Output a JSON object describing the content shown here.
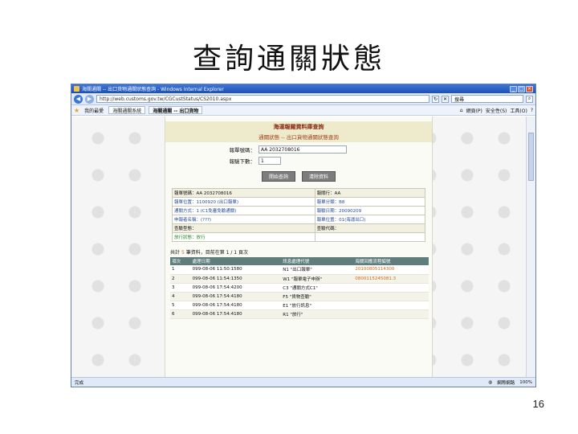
{
  "slide": {
    "title": "查詢通關狀態",
    "page_number": "16"
  },
  "browser": {
    "window_title": "海關通關 -- 出口貨物通關狀態查詢 - Windows Internal Explorer",
    "address": "http://web.customs.gov.tw/CGCustStatus/CS2010.aspx",
    "search_placeholder": "搜尋",
    "favorites_label": "我的最愛",
    "tabs": [
      "海關通關系統",
      "海關通關 -- 出口貨物"
    ],
    "tools": [
      "網頁(P)",
      "安全性(S)",
      "工具(O)"
    ],
    "status_left": "完成",
    "status_zone": "網際網路",
    "status_zoom": "100%"
  },
  "page": {
    "header_title": "海運報關資料庫查詢",
    "header_subtitle": "通關狀態 -- 出口貨物通關狀態查詢",
    "form": {
      "container_label": "報單號碼：",
      "container_value": "AA 2032708016",
      "page_label": "報驗下數：",
      "page_value": "1"
    },
    "buttons": [
      "開始查詢",
      "清除資料"
    ],
    "info_rows": [
      [
        "報單號碼：AA 2032708016",
        "報關行：AA"
      ],
      [
        "報單位置：1100920 (出口報單)",
        "報單分類：B8"
      ],
      [
        "通關方式：1 (C1免審免驗通關)",
        "報驗日期：20090209"
      ],
      [
        "申報者名稱：(???)",
        "報單位置：01(海運出口)"
      ],
      [
        "查驗型態：",
        "查驗代碼："
      ],
      [
        "放行狀態：放行",
        ""
      ]
    ],
    "result_summary_prefix": "共計",
    "result_summary_count": "5",
    "result_summary_suffix": "筆資料，目前在第 1 / 1 頁次",
    "list_headers": [
      "項次",
      "處理日期",
      "訊息處理代號",
      "海關回應流程編號"
    ],
    "list_rows": [
      [
        "1",
        "099-08-06 11:50:1580",
        "N1 \"出口報單\"",
        "20100805114300"
      ],
      [
        "2",
        "099-08-06 11:54:1350",
        "W1 \"報單電子申辦\"",
        "0800115245081.3"
      ],
      [
        "3",
        "099-08-06 17:54:4200",
        "C3 \"通關方式C1\"",
        ""
      ],
      [
        "4",
        "099-08-06 17:54:4180",
        "F5 \"貨物查驗\"",
        ""
      ],
      [
        "5",
        "099-08-06 17:54:4180",
        "E1 \"放行訊息\"",
        ""
      ],
      [
        "6",
        "099-08-06 17:54:4180",
        "R1 \"放行\"",
        ""
      ]
    ]
  }
}
